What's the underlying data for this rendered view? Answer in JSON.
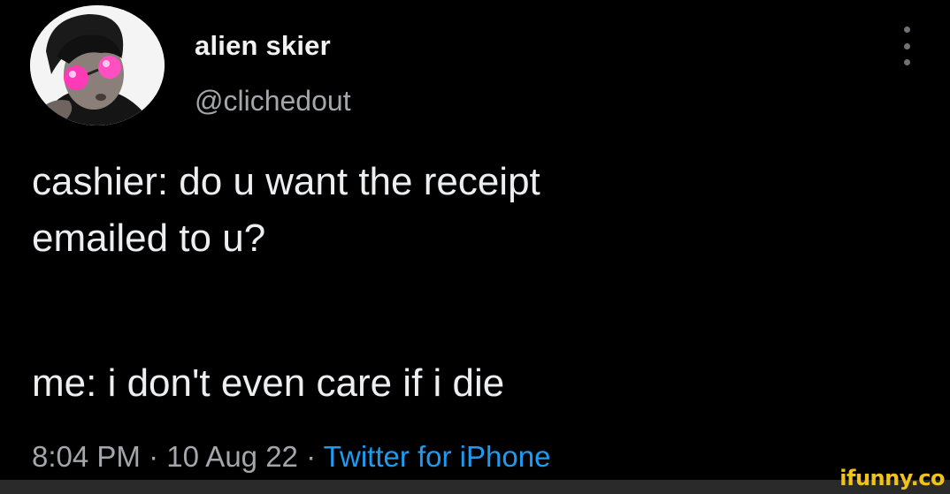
{
  "tweet": {
    "author": {
      "display_name": "alien skier",
      "handle": "@clichedout",
      "avatar_icon": "profile-photo"
    },
    "more_icon": "vertical-ellipsis-icon",
    "text_lines": [
      "cashier: do u want the receipt",
      "emailed to u?",
      "me: i don't even care if i die"
    ],
    "time": "8:04 PM",
    "date": "10 Aug 22",
    "separator": "·",
    "source": "Twitter for iPhone"
  },
  "watermark": {
    "text": "ifunny.co"
  },
  "colors": {
    "background": "#000000",
    "text_primary": "#eceef0",
    "text_secondary": "#a3a6aa",
    "link": "#1d9bf0",
    "watermark": "#f0c21c"
  }
}
